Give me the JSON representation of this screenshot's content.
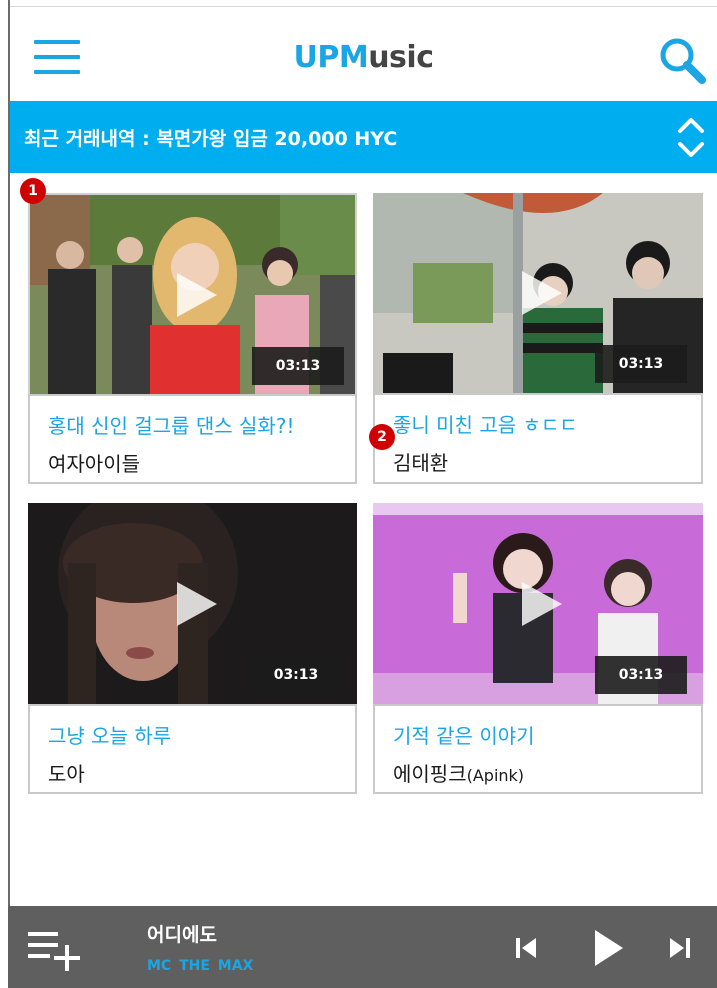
{
  "header": {
    "title_accent": "UPM",
    "title_rest": "usic",
    "menu_icon": "hamburger-menu-icon",
    "search_icon": "magnifier-icon"
  },
  "banner": {
    "text": "최근 거래내역 : 복면가왕 입금 20,000 HYC",
    "arrows_icon": "chevron-up-down-icon"
  },
  "videos": [
    {
      "title": "홍대 신인 걸그룹 댄스 실화?!",
      "artist": "여자아이들",
      "artist_suffix": "",
      "duration": "03:13"
    },
    {
      "title": "좋니 미친 고음 ㅎㄷㄷ",
      "artist": "김태환",
      "artist_suffix": "",
      "duration": "03:13"
    },
    {
      "title": "그냥 오늘 하루",
      "artist": "도아",
      "artist_suffix": "",
      "duration": "03:13"
    },
    {
      "title": "기적 같은 이야기",
      "artist": "에이핑크",
      "artist_suffix": "(Apink)",
      "duration": "03:13"
    }
  ],
  "badges": [
    "1",
    "2"
  ],
  "player": {
    "now_title": "어디에도",
    "now_artist": "MC THE  MAX",
    "playlist_icon": "playlist-add-icon",
    "prev_icon": "skip-previous-icon",
    "play_icon": "play-icon",
    "next_icon": "skip-next-icon"
  },
  "colors": {
    "accent": "#1aa6e4",
    "banner": "#00aeef",
    "player": "#5f5f5f",
    "badge": "#d10000"
  }
}
